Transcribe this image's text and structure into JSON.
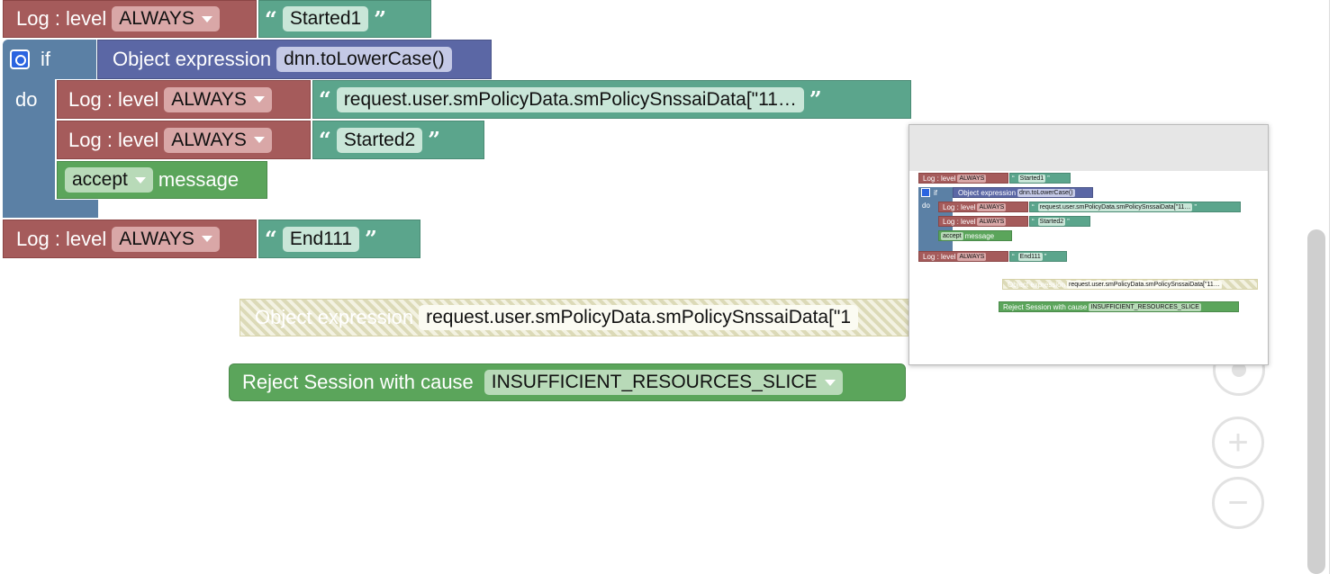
{
  "workspace": {
    "log1": {
      "label": "Log : level",
      "level": "ALWAYS",
      "text": "Started1"
    },
    "if_block": {
      "if_label": "if",
      "do_label": "do",
      "condition": {
        "label": "Object expression",
        "value": "dnn.toLowerCase()"
      }
    },
    "log2": {
      "label": "Log : level",
      "level": "ALWAYS",
      "text": "request.user.smPolicyData.smPolicySnssaiData[\"11…"
    },
    "log3": {
      "label": "Log : level",
      "level": "ALWAYS",
      "text": "Started2"
    },
    "accept": {
      "option": "accept",
      "label": "message"
    },
    "log4": {
      "label": "Log : level",
      "level": "ALWAYS",
      "text": "End111"
    },
    "orphan_object": {
      "label": "Object expression",
      "value": "request.user.smPolicyData.smPolicySnssaiData[\"1"
    },
    "reject": {
      "label": "Reject Session with cause",
      "cause": "INSUFFICIENT_RESOURCES_SLICE"
    }
  },
  "minimap": {
    "log1": {
      "label": "Log : level",
      "level": "ALWAYS",
      "text": "Started1"
    },
    "if_label": "if",
    "do_label": "do",
    "condition": {
      "label": "Object expression",
      "value": "dnn.toLowerCase()"
    },
    "log2": {
      "label": "Log : level",
      "level": "ALWAYS",
      "text": "request.user.smPolicyData.smPolicySnssaiData[\"11…"
    },
    "log3": {
      "label": "Log : level",
      "level": "ALWAYS",
      "text": "Started2"
    },
    "accept": {
      "option": "accept",
      "label": "message"
    },
    "log4": {
      "label": "Log : level",
      "level": "ALWAYS",
      "text": "End111"
    },
    "orphan": {
      "label": "Object expression",
      "value": "request.user.smPolicyData.smPolicySnssaiData[\"11…"
    },
    "reject": {
      "label": "Reject Session with cause",
      "cause": "INSUFFICIENT_RESOURCES_SLICE"
    }
  },
  "controls": {
    "zoom_in": "+",
    "zoom_out": "−"
  }
}
